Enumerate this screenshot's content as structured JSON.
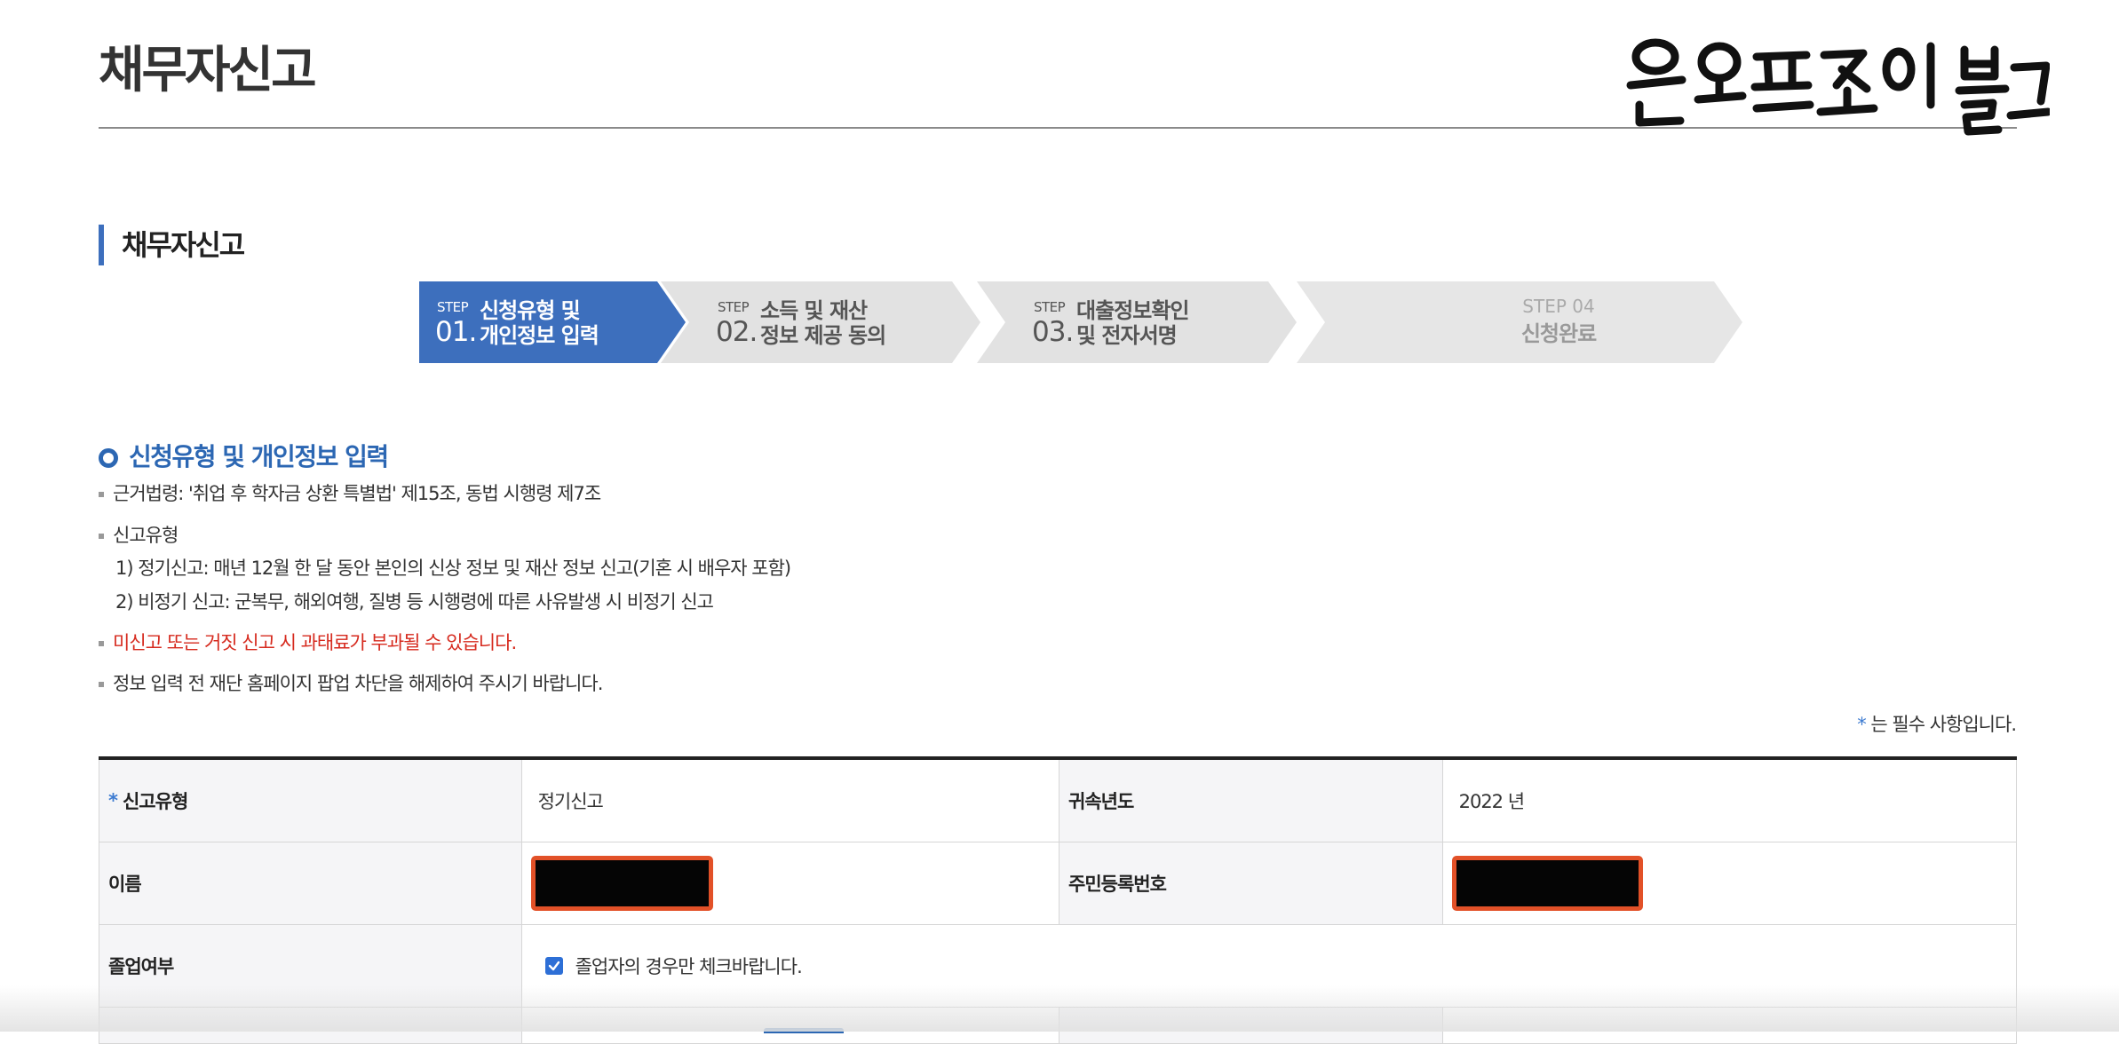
{
  "page": {
    "title": "채무자신고"
  },
  "watermark": {
    "text": "온오프조이 블로그"
  },
  "section": {
    "title": "채무자신고"
  },
  "steps": [
    {
      "small": "STEP",
      "num": "01.",
      "line1": "신청유형 및",
      "line2": "개인정보 입력",
      "state": "active"
    },
    {
      "small": "STEP",
      "num": "02.",
      "line1": "소득 및 재산",
      "line2": "정보 제공 동의",
      "state": "inactive"
    },
    {
      "small": "STEP",
      "num": "03.",
      "line1": "대출정보확인",
      "line2": "및 전자서명",
      "state": "inactive"
    },
    {
      "small": "STEP 04",
      "title": "신청완료",
      "state": "disabled"
    }
  ],
  "subsection": {
    "title": "신청유형 및 개인정보 입력"
  },
  "notes": {
    "law": "근거법령: '취업 후 학자금 상환 특별법' 제15조, 동법 시행령 제7조",
    "type_label": "신고유형",
    "type_1": "1) 정기신고: 매년 12월 한 달 동안 본인의 신상 정보 및 재산 정보 신고(기혼 시 배우자 포함)",
    "type_2": "2) 비정기 신고: 군복무, 해외여행, 질병 등 시행령에 따른 사유발생 시 비정기 신고",
    "warning": "미신고 또는 거짓 신고 시 과태료가 부과될 수 있습니다.",
    "popup": "정보 입력 전 재단 홈페이지 팝업 차단을 해제하여 주시기 바랍니다."
  },
  "required_note": {
    "star": "*",
    "text": " 는 필수 사항입니다."
  },
  "form": {
    "report_type_label": "신고유형",
    "report_type_value": "정기신고",
    "year_label": "귀속년도",
    "year_value": "2022 년",
    "name_label": "이름",
    "rrn_label": "주민등록번호",
    "graduation_label": "졸업여부",
    "graduation_checkbox_label": "졸업자의 경우만 체크바랍니다.",
    "graduation_checked": true
  },
  "colors": {
    "accent": "#3d6fbd",
    "step_active": "#3d6fbd",
    "step_inactive": "#e2e2e2",
    "warning": "#d62a1e"
  }
}
